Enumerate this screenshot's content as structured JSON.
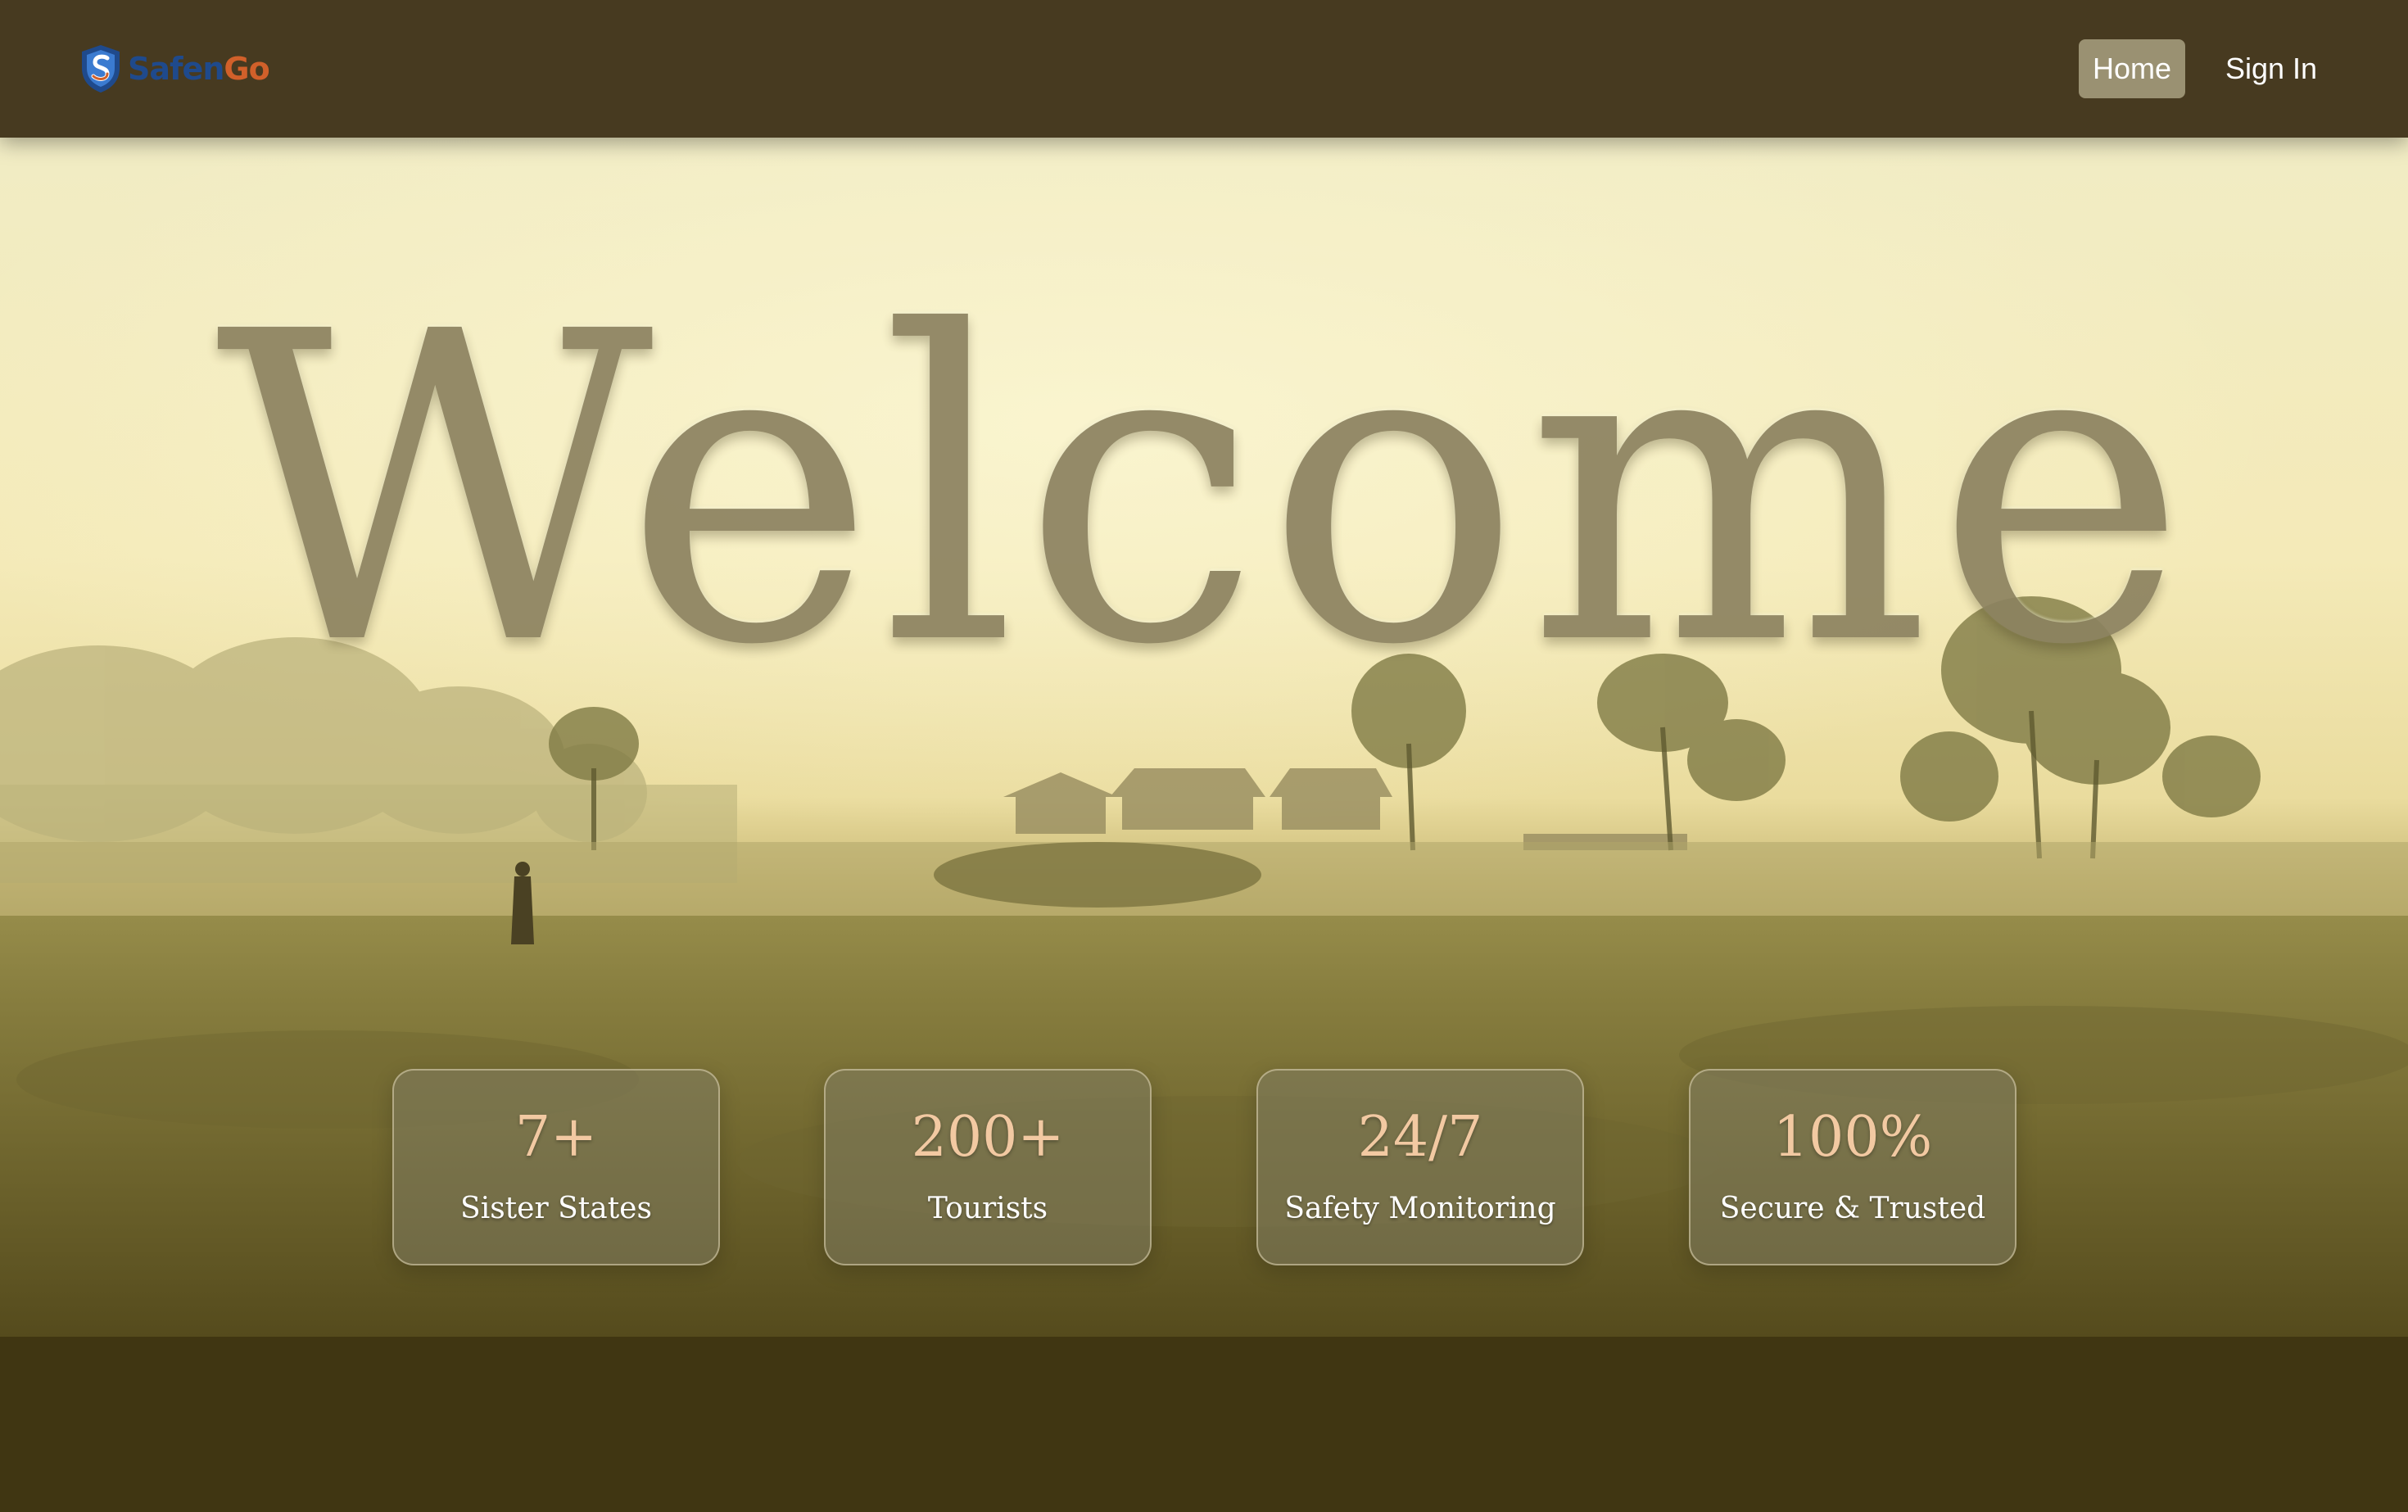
{
  "brand": {
    "name_part1": "Safen",
    "name_part2": "Go",
    "logo_icon": "shield-s-icon",
    "colors": {
      "primary": "#1f4a8c",
      "accent": "#d1602a"
    }
  },
  "nav": {
    "items": [
      {
        "label": "Home",
        "active": true
      },
      {
        "label": "Sign In",
        "active": false
      }
    ]
  },
  "hero": {
    "heading": "Welcome",
    "stats": [
      {
        "value": "7+",
        "label": "Sister States"
      },
      {
        "value": "200+",
        "label": "Tourists"
      },
      {
        "value": "24/7",
        "label": "Safety Monitoring"
      },
      {
        "value": "100%",
        "label": "Secure & Trusted"
      }
    ]
  },
  "theme": {
    "navbar_bg": "#473a20",
    "footer_bg": "#403612",
    "stat_value_color": "#f2c9a2",
    "heading_color": "#8c8260"
  }
}
